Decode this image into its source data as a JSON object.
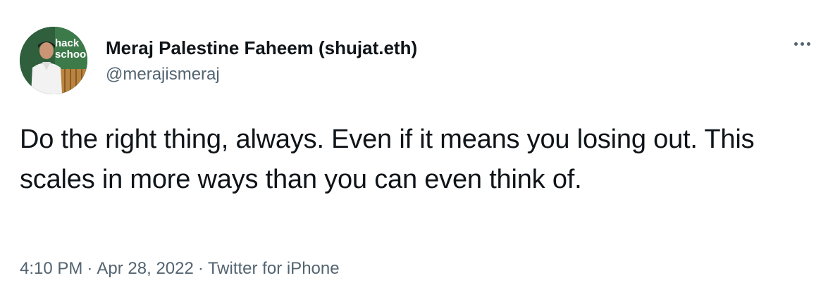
{
  "author": {
    "display_name": "Meraj Palestine Faheem (shujat.eth)",
    "handle": "@merajismeraj",
    "avatar_sign_text": [
      "hack",
      "schoo"
    ]
  },
  "more_icon": "more-horizontal-icon",
  "tweet": {
    "text": "Do the right thing, always. Even if it means you losing out. This scales in more ways than you can even think of."
  },
  "meta": {
    "time": "4:10 PM",
    "separator": "·",
    "date": "Apr 28, 2022",
    "source": "Twitter for iPhone"
  },
  "colors": {
    "text_primary": "#0f1419",
    "text_secondary": "#536471",
    "background": "#ffffff"
  }
}
